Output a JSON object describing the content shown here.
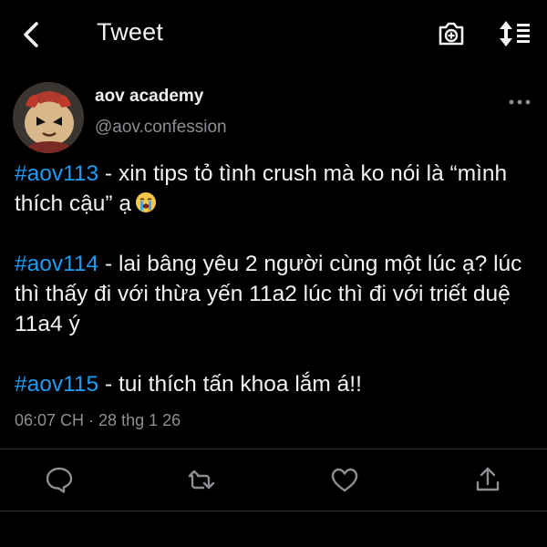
{
  "header": {
    "title": "Tweet",
    "back_icon": "back-chevron-icon",
    "camera_icon": "camera-plus-icon",
    "sort_icon": "sort-list-icon"
  },
  "tweet": {
    "author_name": "aov academy",
    "author_handle": "@aov.confession",
    "paragraphs": [
      {
        "tag": "#aov113",
        "text": " - xin tips tỏ tình crush mà ko nói là “mình thích cậu” ạ",
        "emoji": "crying-face"
      },
      {
        "tag": "#aov114",
        "text": " - lai bâng yêu 2 người cùng một lúc ạ? lúc thì thấy đi với thừa yến 11a2 lúc thì đi với triết duệ 11a4 ý"
      },
      {
        "tag": "#aov115",
        "text": " - tui thích tấn khoa lắm á!!"
      }
    ],
    "timestamp": "06:07 CH · 28 thg 1 26"
  },
  "actions": [
    "reply-icon",
    "retweet-icon",
    "like-icon",
    "share-icon"
  ],
  "colors": {
    "background": "#000000",
    "hashtag": "#1d9bf0",
    "secondary_text": "#8b8f94",
    "divider": "#2f3336"
  }
}
